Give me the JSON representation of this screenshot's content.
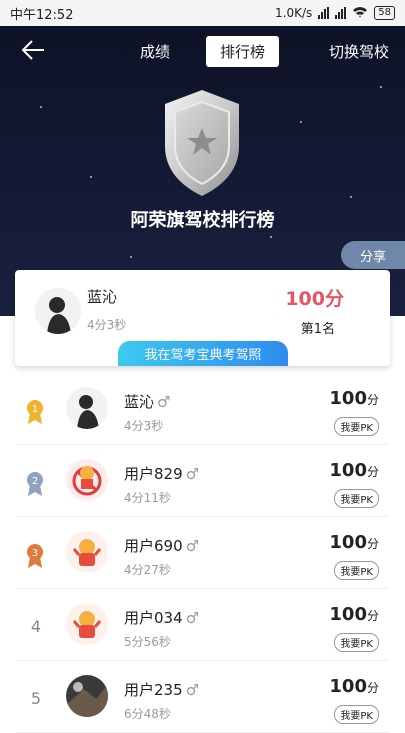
{
  "status_bar": {
    "time": "中午12:52",
    "speed": "1.0K/s",
    "battery": "58"
  },
  "header": {
    "tabs": [
      {
        "label": "成绩"
      },
      {
        "label": "排行榜"
      }
    ],
    "switch_label": "切换驾校",
    "title": "阿荣旗驾校排行榜",
    "share_label": "分享"
  },
  "my_card": {
    "name": "蓝沁",
    "time": "4分3秒",
    "score": "100分",
    "rank": "第1名"
  },
  "promo": {
    "text": "我在驾考宝典考驾照"
  },
  "ranking": [
    {
      "rank": "1",
      "name": "蓝沁",
      "gender": "♂",
      "time": "4分3秒",
      "score": "100",
      "unit": "分",
      "pk": "我要PK",
      "medal_color": "#f0b32d"
    },
    {
      "rank": "2",
      "name": "用户829",
      "gender": "♂",
      "time": "4分11秒",
      "score": "100",
      "unit": "分",
      "pk": "我要PK",
      "medal_color": "#8ea3bd"
    },
    {
      "rank": "3",
      "name": "用户690",
      "gender": "♂",
      "time": "4分27秒",
      "score": "100",
      "unit": "分",
      "pk": "我要PK",
      "medal_color": "#e07a3a"
    },
    {
      "rank": "4",
      "name": "用户034",
      "gender": "♂",
      "time": "5分56秒",
      "score": "100",
      "unit": "分",
      "pk": "我要PK"
    },
    {
      "rank": "5",
      "name": "用户235",
      "gender": "♂",
      "time": "6分48秒",
      "score": "100",
      "unit": "分",
      "pk": "我要PK"
    }
  ]
}
